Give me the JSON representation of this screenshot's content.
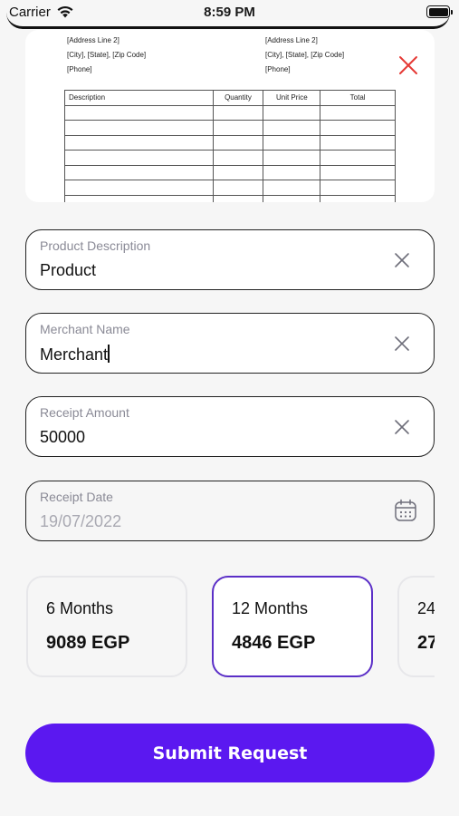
{
  "status_bar": {
    "carrier": "Carrier",
    "time": "8:59 PM",
    "icons": [
      "wifi-icon",
      "battery-icon"
    ]
  },
  "receipt_preview": {
    "left_address": [
      "[Address Line 2]",
      "[City], [State], [Zip Code]",
      "[Phone]"
    ],
    "right_address": [
      "[Address Line 2]",
      "[City], [State], [Zip Code]",
      "[Phone]"
    ],
    "table_headers": [
      "Description",
      "Quantity",
      "Unit Price",
      "Total"
    ],
    "close_icon": "close-x-icon",
    "close_color": "#e53935"
  },
  "form": {
    "product_description": {
      "label": "Product Description",
      "value": "Product",
      "icon": "clear-x-icon"
    },
    "merchant_name": {
      "label": "Merchant Name",
      "value": "Merchant",
      "icon": "clear-x-icon"
    },
    "receipt_amount": {
      "label": "Receipt Amount",
      "value": "50000",
      "icon": "clear-x-icon"
    },
    "receipt_date": {
      "label": "Receipt Date",
      "value": "19/07/2022",
      "icon": "calendar-icon"
    }
  },
  "installment_plans": [
    {
      "months": "6 Months",
      "amount": "9089 EGP",
      "selected": false
    },
    {
      "months": "12 Months",
      "amount": "4846 EGP",
      "selected": true
    },
    {
      "months": "24",
      "amount": "27",
      "selected": false
    }
  ],
  "submit_label": "Submit Request",
  "colors": {
    "accent": "#5b18f0",
    "selected_border": "#5b2fc7",
    "background": "#f6f6f6",
    "label": "#8a8a96"
  }
}
